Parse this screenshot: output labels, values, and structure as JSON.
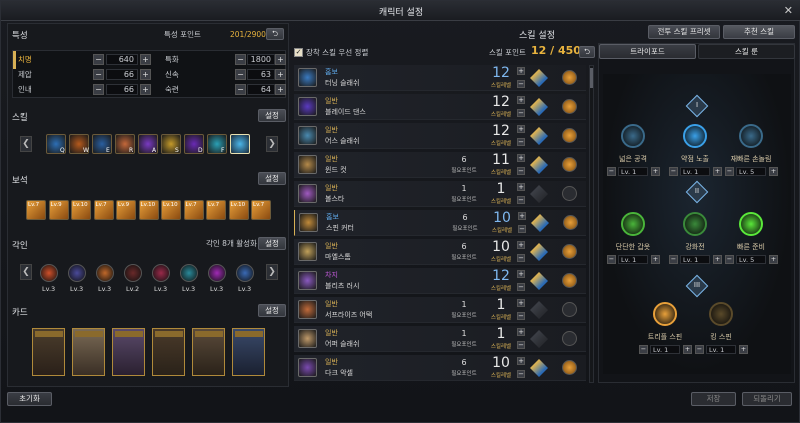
{
  "window": {
    "title": "캐릭터 설정",
    "close": "✕"
  },
  "stats": {
    "header": "특성",
    "points_label": "특성 포인트",
    "points_value": "201/2900",
    "left": [
      {
        "label": "치명",
        "value": "640"
      },
      {
        "label": "제압",
        "value": "66"
      },
      {
        "label": "인내",
        "value": "66"
      }
    ],
    "right": [
      {
        "label": "특화",
        "value": "1800"
      },
      {
        "label": "신속",
        "value": "63"
      },
      {
        "label": "숙련",
        "value": "64"
      }
    ]
  },
  "skill_section": {
    "header": "스킬",
    "settings": "설정",
    "keys": [
      "Q",
      "W",
      "E",
      "R",
      "A",
      "S",
      "D",
      "F"
    ]
  },
  "gem_section": {
    "header": "보석",
    "settings": "설정",
    "levels": [
      "Lv.7",
      "Lv.9",
      "Lv.10",
      "Lv.7",
      "Lv.9",
      "Lv.10",
      "Lv.10",
      "Lv.7",
      "Lv.7",
      "Lv.10",
      "Lv.7"
    ]
  },
  "engraving_section": {
    "header": "각인",
    "active": "각인 8개 활성화",
    "settings": "설정",
    "levels": [
      "Lv.3",
      "Lv.3",
      "Lv.3",
      "Lv.2",
      "Lv.3",
      "Lv.3",
      "Lv.3",
      "Lv.3"
    ]
  },
  "card_section": {
    "header": "카드",
    "settings": "설정"
  },
  "reset_button": "초기화",
  "skill_settings": {
    "header": "스킬 설정",
    "checkbox_label": "장착 스킬 우선 정렬",
    "points_label": "스킬 포인트",
    "points_value": "12 / 450",
    "point_word": "필요포인트",
    "level_word": "스킬레벨",
    "rows": [
      {
        "grade": "홈보",
        "name": "터닝 슬래쉬",
        "points": "",
        "level": "12",
        "color": "#5fa8e8"
      },
      {
        "grade": "일반",
        "name": "블레이드 댄스",
        "points": "",
        "level": "12",
        "color": "#d7b055"
      },
      {
        "grade": "일반",
        "name": "어스 슬래쉬",
        "points": "",
        "level": "12",
        "color": "#d7b055"
      },
      {
        "grade": "일반",
        "name": "윈드 컷",
        "points": "6",
        "level": "11",
        "color": "#d7b055"
      },
      {
        "grade": "일반",
        "name": "볼스타",
        "points": "1",
        "level": "1",
        "color": "#d7b055"
      },
      {
        "grade": "홈보",
        "name": "스핀 커터",
        "points": "6",
        "level": "10",
        "color": "#5fa8e8"
      },
      {
        "grade": "일반",
        "name": "마엘스톰",
        "points": "6",
        "level": "10",
        "color": "#d7b055"
      },
      {
        "grade": "차지",
        "name": "블리츠 러시",
        "points": "",
        "level": "12",
        "color": "#c05ad8"
      },
      {
        "grade": "일반",
        "name": "서프라이즈 어택",
        "points": "1",
        "level": "1",
        "color": "#d7b055"
      },
      {
        "grade": "일반",
        "name": "어퍼 슬래쉬",
        "points": "1",
        "level": "1",
        "color": "#d7b055"
      },
      {
        "grade": "일반",
        "name": "다크 악셀",
        "points": "6",
        "level": "10",
        "color": "#d7b055"
      }
    ]
  },
  "tabs": {
    "preset": "전투 스킬 프리셋",
    "recommended": "추천 스킬"
  },
  "tripod": {
    "tab_tripod": "트라이포드",
    "tab_rune": "스킬 룬",
    "row1": [
      {
        "name": "넓은 공격",
        "lv": "Lv. 1"
      },
      {
        "name": "약점 노출",
        "lv": "Lv. 1"
      },
      {
        "name": "재빠른 손놀림",
        "lv": "Lv. 5"
      }
    ],
    "row2": [
      {
        "name": "단단한 갑옷",
        "lv": "Lv. 1"
      },
      {
        "name": "강화전",
        "lv": "Lv. 1"
      },
      {
        "name": "빠른 준비",
        "lv": "Lv. 5"
      }
    ],
    "row3": [
      {
        "name": "트리플 스핀",
        "lv": "Lv. 1"
      },
      {
        "name": "킹 스핀",
        "lv": "Lv. 1"
      }
    ],
    "tier_marks": [
      "I",
      "II",
      "III"
    ]
  },
  "footer": {
    "save": "저장",
    "revert": "되돌리기"
  }
}
